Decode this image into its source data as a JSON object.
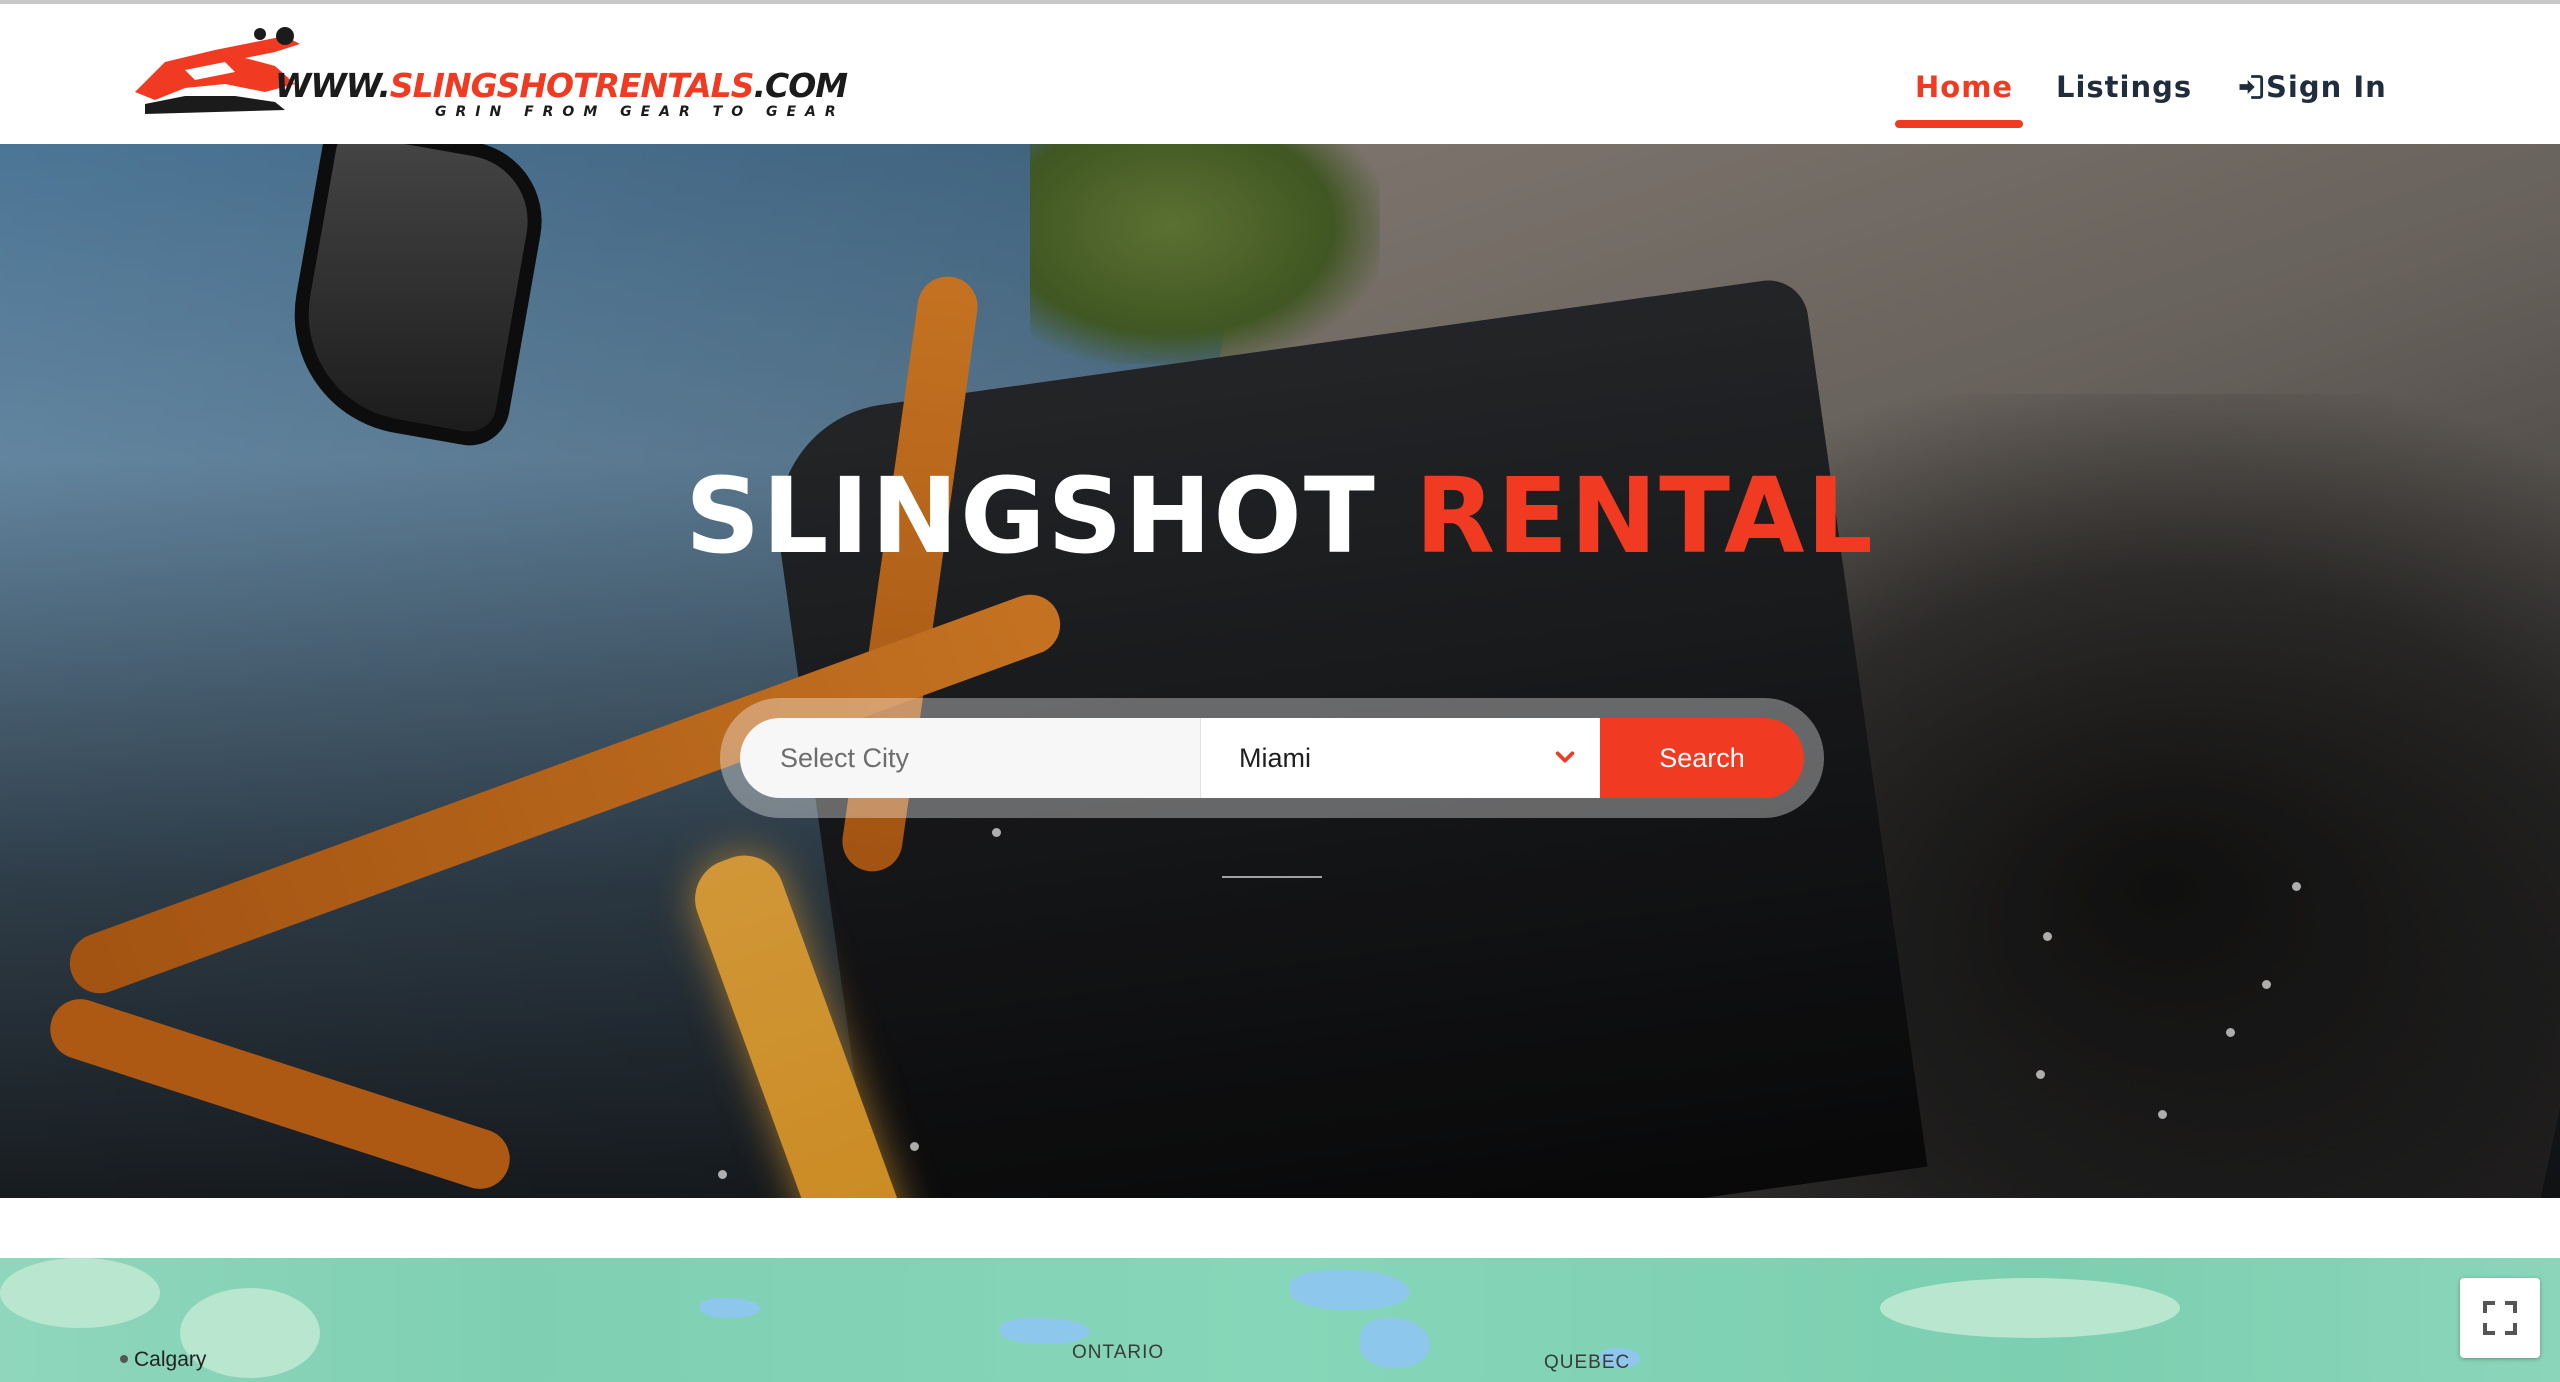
{
  "header": {
    "logo": {
      "domain_prefix": "WWW.",
      "domain_name": "SLINGSHOTRENTALS",
      "domain_tld": ".COM",
      "tagline": "GRIN FROM GEAR TO GEAR"
    },
    "nav": {
      "home": "Home",
      "listings": "Listings",
      "sign_in": "Sign In"
    },
    "active_nav": "home"
  },
  "hero": {
    "title_main": "SLINGSHOT",
    "title_accent": "RENTAL",
    "search": {
      "placeholder": "Select City",
      "selected_city": "Miami",
      "button_label": "Search"
    }
  },
  "map": {
    "labels": {
      "calgary": "Calgary",
      "ontario": "ONTARIO",
      "quebec": "QUEBEC"
    }
  },
  "colors": {
    "accent": "#f03a22",
    "nav_text": "#1f2d3d",
    "map_land": "#86d6b9",
    "map_water": "#8ec7ec"
  },
  "icons": {
    "sign_in": "sign-in-icon",
    "select_chevron": "chevron-down-icon",
    "fullscreen": "fullscreen-icon",
    "logo_car": "slingshot-car-icon"
  }
}
